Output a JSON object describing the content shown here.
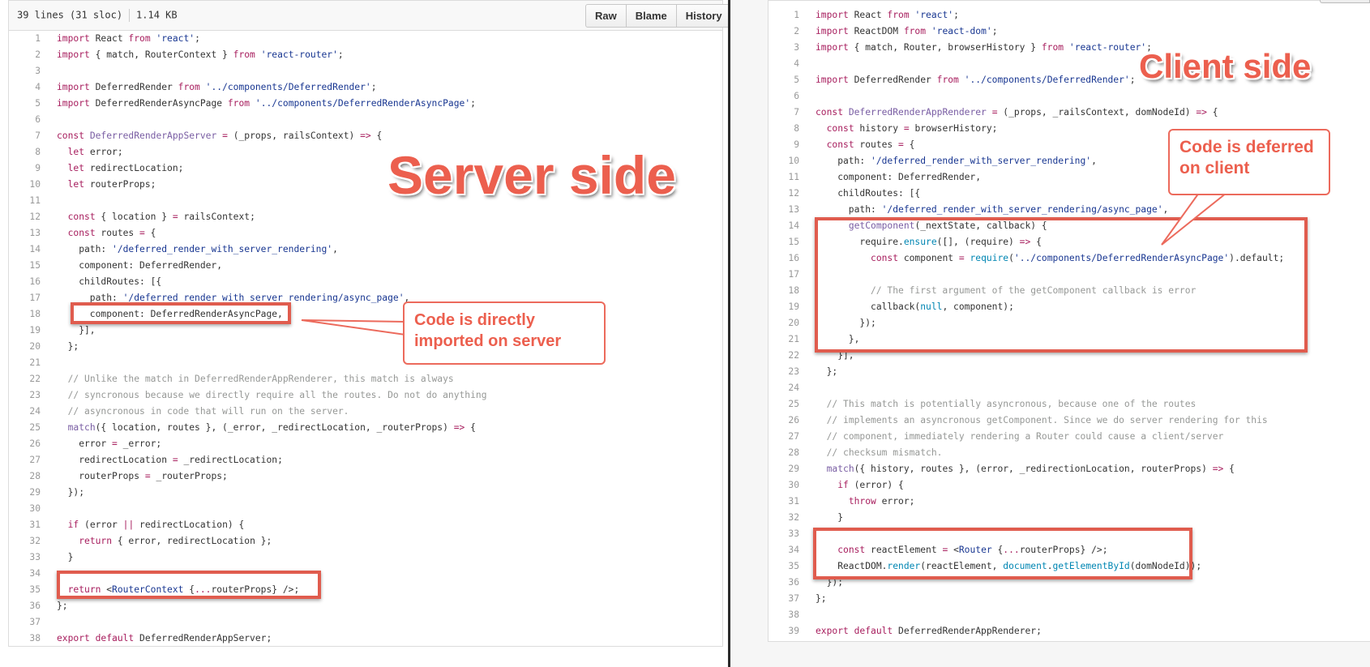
{
  "left_panel": {
    "file_info": {
      "lines": "39 lines (31 sloc)",
      "size": "1.14 KB"
    },
    "buttons": {
      "raw": "Raw",
      "blame": "Blame",
      "history": "History"
    },
    "title": "Server side",
    "callout": "Code is directly imported on server",
    "lines": [
      {
        "n": "1",
        "html": "<span class=\"k\">import</span> React <span class=\"k\">from</span> <span class=\"s\">'react'</span>;"
      },
      {
        "n": "2",
        "html": "<span class=\"k\">import</span> { match, RouterContext } <span class=\"k\">from</span> <span class=\"s\">'react-router'</span>;"
      },
      {
        "n": "3",
        "html": ""
      },
      {
        "n": "4",
        "html": "<span class=\"k\">import</span> DeferredRender <span class=\"k\">from</span> <span class=\"s\">'../components/DeferredRender'</span>;"
      },
      {
        "n": "5",
        "html": "<span class=\"k\">import</span> DeferredRenderAsyncPage <span class=\"k\">from</span> <span class=\"s\">'../components/DeferredRenderAsyncPage'</span>;"
      },
      {
        "n": "6",
        "html": ""
      },
      {
        "n": "7",
        "html": "<span class=\"k\">const</span> <span class=\"f\">DeferredRenderAppServer</span> <span class=\"k\">=</span> (_props, railsContext) <span class=\"k\">=&gt;</span> {"
      },
      {
        "n": "8",
        "html": "  <span class=\"k\">let</span> error;"
      },
      {
        "n": "9",
        "html": "  <span class=\"k\">let</span> redirectLocation;"
      },
      {
        "n": "10",
        "html": "  <span class=\"k\">let</span> routerProps;"
      },
      {
        "n": "11",
        "html": ""
      },
      {
        "n": "12",
        "html": "  <span class=\"k\">const</span> { location } <span class=\"k\">=</span> railsContext;"
      },
      {
        "n": "13",
        "html": "  <span class=\"k\">const</span> routes <span class=\"k\">=</span> {"
      },
      {
        "n": "14",
        "html": "    path: <span class=\"s\">'/deferred_render_with_server_rendering'</span>,"
      },
      {
        "n": "15",
        "html": "    component: DeferredRender,"
      },
      {
        "n": "16",
        "html": "    childRoutes: [{"
      },
      {
        "n": "17",
        "html": "      path: <span class=\"s\">'/deferred_render_with_server_rendering/async_page'</span>,"
      },
      {
        "n": "18",
        "html": "      component: DeferredRenderAsyncPage,"
      },
      {
        "n": "19",
        "html": "    }],"
      },
      {
        "n": "20",
        "html": "  };"
      },
      {
        "n": "21",
        "html": ""
      },
      {
        "n": "22",
        "html": "  <span class=\"c\">// Unlike the match in DeferredRenderAppRenderer, this match is always</span>"
      },
      {
        "n": "23",
        "html": "  <span class=\"c\">// syncronous because we directly require all the routes. Do not do anything</span>"
      },
      {
        "n": "24",
        "html": "  <span class=\"c\">// asyncronous in code that will run on the server.</span>"
      },
      {
        "n": "25",
        "html": "  <span class=\"f\">match</span>({ location, routes }, (_error, _redirectLocation, _routerProps) <span class=\"k\">=&gt;</span> {"
      },
      {
        "n": "26",
        "html": "    error <span class=\"k\">=</span> _error;"
      },
      {
        "n": "27",
        "html": "    redirectLocation <span class=\"k\">=</span> _redirectLocation;"
      },
      {
        "n": "28",
        "html": "    routerProps <span class=\"k\">=</span> _routerProps;"
      },
      {
        "n": "29",
        "html": "  });"
      },
      {
        "n": "30",
        "html": ""
      },
      {
        "n": "31",
        "html": "  <span class=\"k\">if</span> (error <span class=\"k\">||</span> redirectLocation) {"
      },
      {
        "n": "32",
        "html": "    <span class=\"k\">return</span> { error, redirectLocation };"
      },
      {
        "n": "33",
        "html": "  }"
      },
      {
        "n": "34",
        "html": ""
      },
      {
        "n": "35",
        "html": "  <span class=\"k\">return</span> &lt;<span class=\"s\">RouterContext</span> {<span class=\"k\">...</span>routerProps} /&gt;;"
      },
      {
        "n": "36",
        "html": "};"
      },
      {
        "n": "37",
        "html": ""
      },
      {
        "n": "38",
        "html": "<span class=\"k\">export</span> <span class=\"k\">default</span> DeferredRenderAppServer;"
      }
    ]
  },
  "right_panel": {
    "title": "Client side",
    "callout": "Code is deferred on client",
    "lines": [
      {
        "n": "1",
        "html": "<span class=\"k\">import</span> React <span class=\"k\">from</span> <span class=\"s\">'react'</span>;"
      },
      {
        "n": "2",
        "html": "<span class=\"k\">import</span> ReactDOM <span class=\"k\">from</span> <span class=\"s\">'react-dom'</span>;"
      },
      {
        "n": "3",
        "html": "<span class=\"k\">import</span> { match, Router, browserHistory } <span class=\"k\">from</span> <span class=\"s\">'react-router'</span>;"
      },
      {
        "n": "4",
        "html": ""
      },
      {
        "n": "5",
        "html": "<span class=\"k\">import</span> DeferredRender <span class=\"k\">from</span> <span class=\"s\">'../components/DeferredRender'</span>;"
      },
      {
        "n": "6",
        "html": ""
      },
      {
        "n": "7",
        "html": "<span class=\"k\">const</span> <span class=\"f\">DeferredRenderAppRenderer</span> <span class=\"k\">=</span> (_props, _railsContext, domNodeId) <span class=\"k\">=&gt;</span> {"
      },
      {
        "n": "8",
        "html": "  <span class=\"k\">const</span> history <span class=\"k\">=</span> browserHistory;"
      },
      {
        "n": "9",
        "html": "  <span class=\"k\">const</span> routes <span class=\"k\">=</span> {"
      },
      {
        "n": "10",
        "html": "    path: <span class=\"s\">'/deferred_render_with_server_rendering'</span>,"
      },
      {
        "n": "11",
        "html": "    component: DeferredRender,"
      },
      {
        "n": "12",
        "html": "    childRoutes: [{"
      },
      {
        "n": "13",
        "html": "      path: <span class=\"s\">'/deferred_render_with_server_rendering/async_page'</span>,"
      },
      {
        "n": "14",
        "html": "      <span class=\"f\">getComponent</span>(_nextState, callback) {"
      },
      {
        "n": "15",
        "html": "        require.<span class=\"b\">ensure</span>([], (require) <span class=\"k\">=&gt;</span> {"
      },
      {
        "n": "16",
        "html": "          <span class=\"k\">const</span> component <span class=\"k\">=</span> <span class=\"b\">require</span>(<span class=\"s\">'../components/DeferredRenderAsyncPage'</span>).default;"
      },
      {
        "n": "17",
        "html": ""
      },
      {
        "n": "18",
        "html": "          <span class=\"c\">// The first argument of the getComponent callback is error</span>"
      },
      {
        "n": "19",
        "html": "          callback(<span class=\"b\">null</span>, component);"
      },
      {
        "n": "20",
        "html": "        });"
      },
      {
        "n": "21",
        "html": "      },"
      },
      {
        "n": "22",
        "html": "    }],"
      },
      {
        "n": "23",
        "html": "  };"
      },
      {
        "n": "24",
        "html": ""
      },
      {
        "n": "25",
        "html": "  <span class=\"c\">// This match is potentially asyncronous, because one of the routes</span>"
      },
      {
        "n": "26",
        "html": "  <span class=\"c\">// implements an asyncronous getComponent. Since we do server rendering for this</span>"
      },
      {
        "n": "27",
        "html": "  <span class=\"c\">// component, immediately rendering a Router could cause a client/server</span>"
      },
      {
        "n": "28",
        "html": "  <span class=\"c\">// checksum mismatch.</span>"
      },
      {
        "n": "29",
        "html": "  <span class=\"f\">match</span>({ history, routes }, (error, _redirectionLocation, routerProps) <span class=\"k\">=&gt;</span> {"
      },
      {
        "n": "30",
        "html": "    <span class=\"k\">if</span> (error) {"
      },
      {
        "n": "31",
        "html": "      <span class=\"k\">throw</span> error;"
      },
      {
        "n": "32",
        "html": "    }"
      },
      {
        "n": "33",
        "html": ""
      },
      {
        "n": "34",
        "html": "    <span class=\"k\">const</span> reactElement <span class=\"k\">=</span> &lt;<span class=\"s\">Router</span> {<span class=\"k\">...</span>routerProps} /&gt;;"
      },
      {
        "n": "35",
        "html": "    ReactDOM.<span class=\"b\">render</span>(reactElement, <span class=\"b\">document</span>.<span class=\"b\">getElementById</span>(domNodeId));"
      },
      {
        "n": "36",
        "html": "  });"
      },
      {
        "n": "37",
        "html": "};"
      },
      {
        "n": "38",
        "html": ""
      },
      {
        "n": "39",
        "html": "<span class=\"k\">export</span> <span class=\"k\">default</span> DeferredRenderAppRenderer;"
      }
    ]
  },
  "colors": {
    "annotation": "#ec5f4e",
    "keyword": "#a71d5d",
    "string": "#183691",
    "comment": "#969896"
  }
}
